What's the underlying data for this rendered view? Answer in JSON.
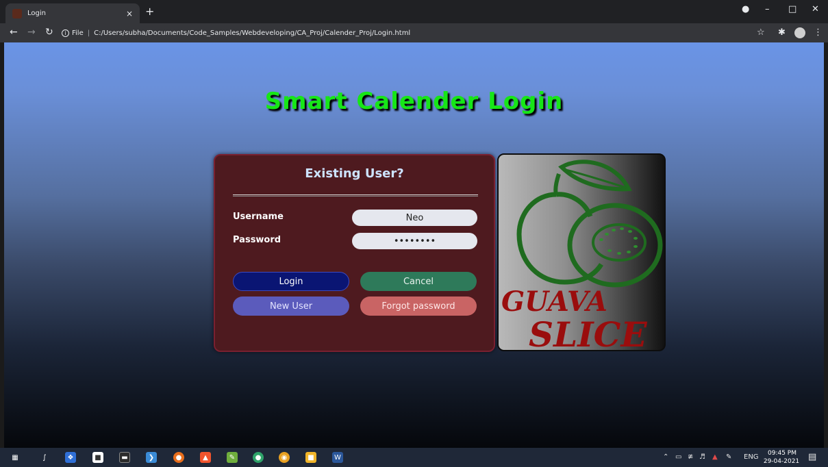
{
  "browser": {
    "tab_title": "Login",
    "tab_close": "×",
    "new_tab": "+",
    "address_prefix": "File",
    "address_url": "C:/Users/subha/Documents/Code_Samples/Webdeveloping/CA_Proj/Calender_Proj/Login.html"
  },
  "page": {
    "title": "Smart Calender Login",
    "card_heading": "Existing User?",
    "username_label": "Username",
    "username_value": "Neo",
    "password_label": "Password",
    "password_value": "••••••••",
    "login_label": "Login",
    "cancel_label": "Cancel",
    "new_user_label": "New User",
    "forgot_label": "Forgot password"
  },
  "logo": {
    "line1": "GUAVA",
    "line2": "SLICE"
  },
  "taskbar": {
    "language": "ENG",
    "time": "09:45 PM",
    "date": "29-04-2021"
  },
  "colors": {
    "title_green": "#17e617",
    "card_background": "#4e1a1f",
    "login_button": "#0a1573",
    "cancel_button": "#2e7a5a",
    "new_user_button": "#5b5bbc",
    "forgot_button": "#c96464"
  }
}
